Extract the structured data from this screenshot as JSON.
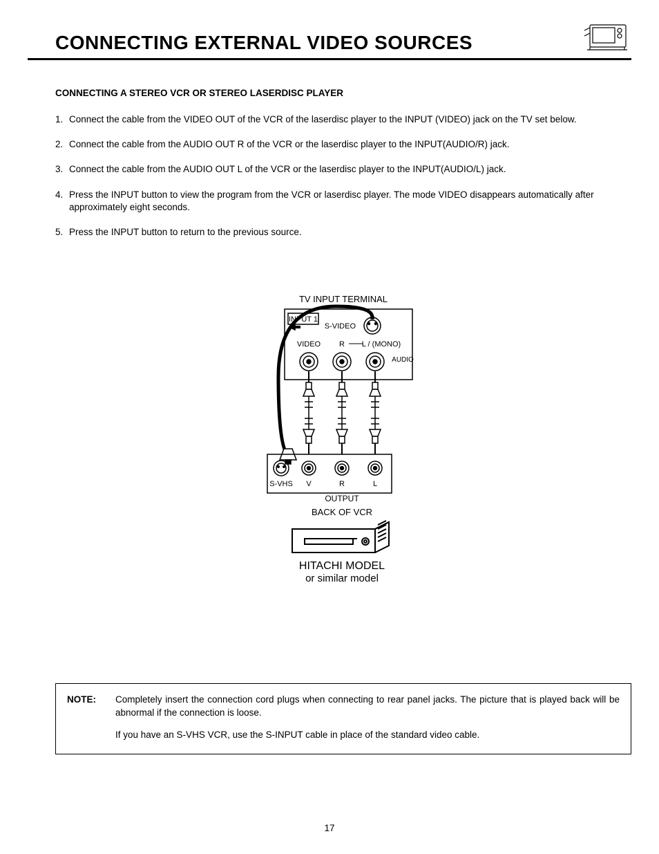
{
  "header": {
    "title": "CONNECTING EXTERNAL VIDEO SOURCES"
  },
  "section": {
    "heading": "CONNECTING A STEREO VCR OR STEREO LASERDISC PLAYER",
    "steps": [
      "Connect the cable from the VIDEO OUT of the VCR of the laserdisc player to the INPUT (VIDEO) jack on the TV set below.",
      "Connect the cable from the AUDIO OUT R of the VCR or the laserdisc player to the INPUT(AUDIO/R) jack.",
      "Connect the cable from the AUDIO OUT L of the VCR or the laserdisc player to the INPUT(AUDIO/L) jack.",
      "Press the INPUT button to view the program from the VCR or laserdisc player.  The mode VIDEO disappears automatically after approximately eight seconds.",
      "Press the INPUT button to return to the previous source."
    ]
  },
  "diagram": {
    "top_label": "TV INPUT TERMINAL",
    "panel_label": "INPUT 1",
    "svideo": "S-VIDEO",
    "video": "VIDEO",
    "r": "R",
    "l_mono": "L / (MONO)",
    "audio": "AUDIO",
    "svhs": "S-VHS",
    "v": "V",
    "r_lower": "R",
    "l_lower": "L",
    "output": "OUTPUT",
    "back_vcr": "BACK OF VCR",
    "model_line1": "HITACHI MODEL",
    "model_line2": "or similar model"
  },
  "note": {
    "label": "NOTE:",
    "para1": "Completely insert the connection cord plugs when connecting to rear panel jacks.  The picture that is played back will be abnormal if the connection is loose.",
    "para2": "If you have an S-VHS VCR, use the S-INPUT cable in place of the standard video cable."
  },
  "page_number": "17"
}
